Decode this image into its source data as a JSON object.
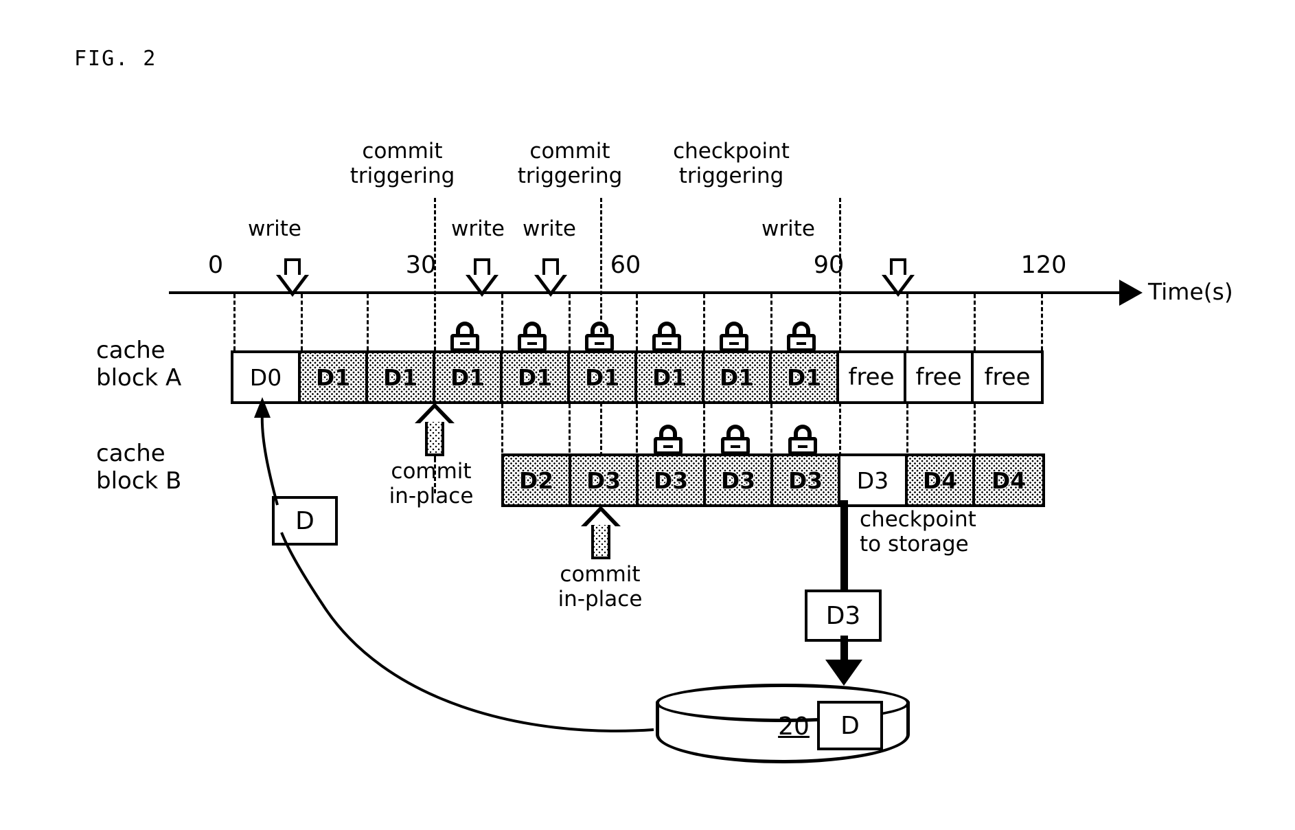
{
  "figure": {
    "title": "FIG. 2",
    "time_axis_caption": "Time(s)"
  },
  "annotations": {
    "commit_triggering_1": "commit\ntriggering",
    "commit_triggering_2": "commit\ntriggering",
    "checkpoint_triggering": "checkpoint\ntriggering",
    "write_1": "write",
    "write_2": "write",
    "write_3": "write",
    "write_4": "write",
    "commit_in_place_1": "commit\nin-place",
    "commit_in_place_2": "commit\nin-place",
    "checkpoint_to_storage": "checkpoint\nto storage"
  },
  "axis": {
    "ticks": [
      "0",
      "30",
      "60",
      "90",
      "120"
    ]
  },
  "rows": [
    {
      "label": "cache\nblock A",
      "cells": [
        {
          "text": "D0",
          "dirty": false,
          "lock": false
        },
        {
          "text": "D1",
          "dirty": true,
          "lock": false
        },
        {
          "text": "D1",
          "dirty": true,
          "lock": false
        },
        {
          "text": "D1",
          "dirty": true,
          "lock": true
        },
        {
          "text": "D1",
          "dirty": true,
          "lock": true
        },
        {
          "text": "D1",
          "dirty": true,
          "lock": true
        },
        {
          "text": "D1",
          "dirty": true,
          "lock": true
        },
        {
          "text": "D1",
          "dirty": true,
          "lock": true
        },
        {
          "text": "D1",
          "dirty": true,
          "lock": true
        },
        {
          "text": "free",
          "dirty": false,
          "lock": false
        },
        {
          "text": "free",
          "dirty": false,
          "lock": false
        },
        {
          "text": "free",
          "dirty": false,
          "lock": false
        }
      ]
    },
    {
      "label": "cache\nblock B",
      "cells": [
        {
          "text": "D2",
          "dirty": true,
          "lock": false
        },
        {
          "text": "D3",
          "dirty": true,
          "lock": false
        },
        {
          "text": "D3",
          "dirty": true,
          "lock": true
        },
        {
          "text": "D3",
          "dirty": true,
          "lock": true
        },
        {
          "text": "D3",
          "dirty": true,
          "lock": true
        },
        {
          "text": "D3",
          "dirty": false,
          "lock": false
        },
        {
          "text": "D4",
          "dirty": true,
          "lock": false
        },
        {
          "text": "D4",
          "dirty": true,
          "lock": false
        }
      ]
    }
  ],
  "boxes": {
    "d_source": "D",
    "d3_transit": "D3",
    "storage_d": "D",
    "storage_number": "20"
  },
  "colors": {
    "stroke": "#000000",
    "background": "#ffffff",
    "dirty_fill": "#ffffff"
  }
}
